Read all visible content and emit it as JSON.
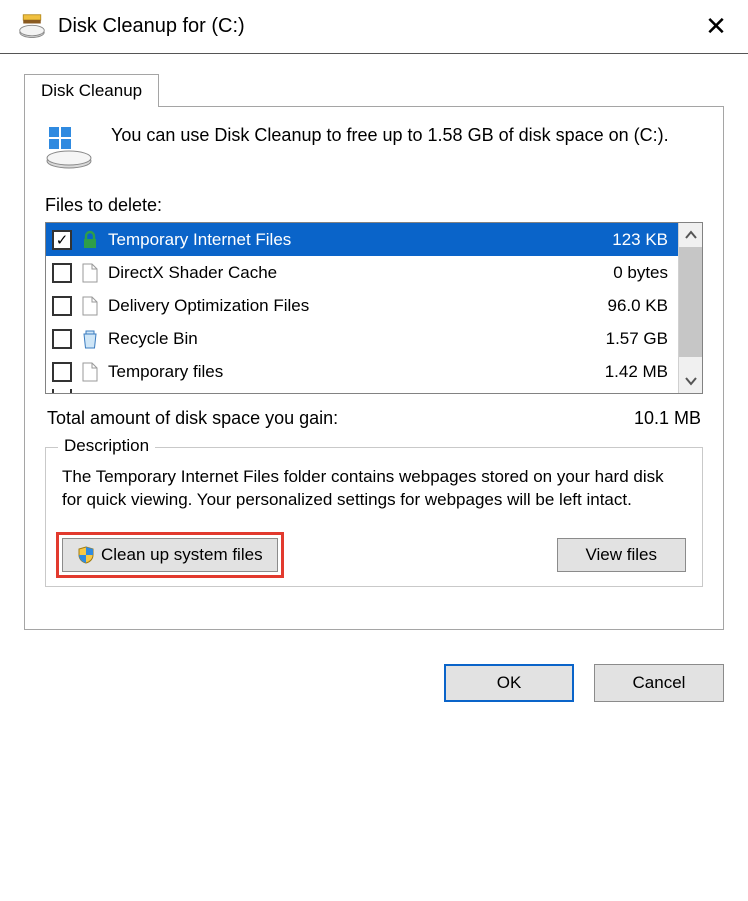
{
  "window": {
    "title": "Disk Cleanup for  (C:)"
  },
  "tab": {
    "label": "Disk Cleanup"
  },
  "intro": "You can use Disk Cleanup to free up to 1.58 GB of disk space on  (C:).",
  "files_label": "Files to delete:",
  "items": [
    {
      "checked": true,
      "icon": "lock",
      "name": "Temporary Internet Files",
      "size": "123 KB",
      "selected": true
    },
    {
      "checked": false,
      "icon": "file",
      "name": "DirectX Shader Cache",
      "size": "0 bytes",
      "selected": false
    },
    {
      "checked": false,
      "icon": "file",
      "name": "Delivery Optimization Files",
      "size": "96.0 KB",
      "selected": false
    },
    {
      "checked": false,
      "icon": "recycle",
      "name": "Recycle Bin",
      "size": "1.57 GB",
      "selected": false
    },
    {
      "checked": false,
      "icon": "file",
      "name": "Temporary files",
      "size": "1.42 MB",
      "selected": false
    }
  ],
  "total": {
    "label": "Total amount of disk space you gain:",
    "value": "10.1 MB"
  },
  "description": {
    "group_title": "Description",
    "text": "The Temporary Internet Files folder contains webpages stored on your hard disk for quick viewing. Your personalized settings for webpages will be left intact."
  },
  "buttons": {
    "clean_system": "Clean up system files",
    "view_files": "View files",
    "ok": "OK",
    "cancel": "Cancel"
  }
}
